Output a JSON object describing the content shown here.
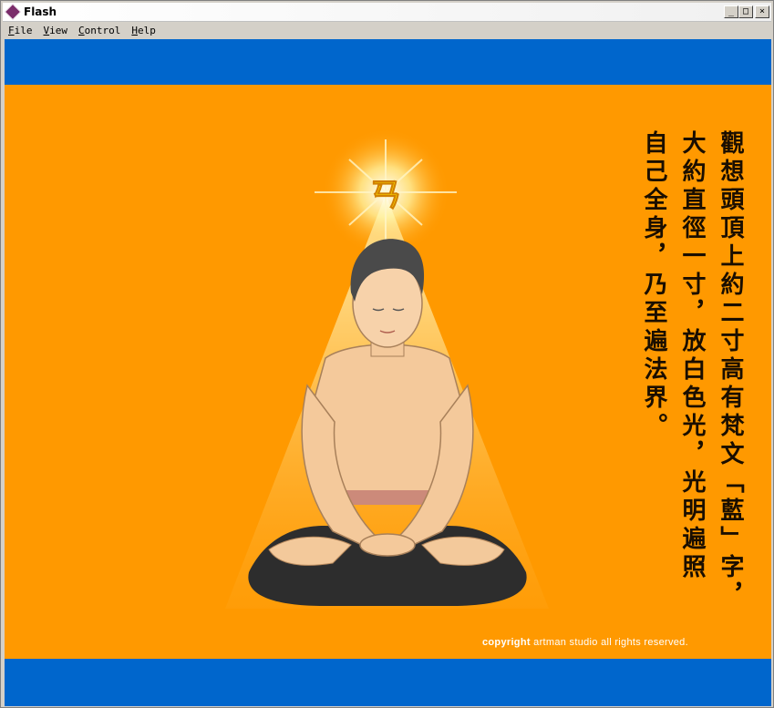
{
  "window": {
    "title": "Flash"
  },
  "menubar": {
    "items": [
      "File",
      "View",
      "Control",
      "Help"
    ]
  },
  "controls": {
    "minimize": "_",
    "maximize": "□",
    "close": "×"
  },
  "colors": {
    "stage": "#ff9900",
    "band": "#0066cc",
    "text": "#1a0e00"
  },
  "content": {
    "columns": [
      "觀想頭頂上約二寸高有梵文「藍」字，",
      "大約直徑一寸，放白色光，光明遍照",
      "自己全身，乃至遍法界。"
    ],
    "glyph": "ㄢ",
    "copyright_bold": "copyright",
    "copyright_rest": " artman studio  all rights reserved."
  }
}
